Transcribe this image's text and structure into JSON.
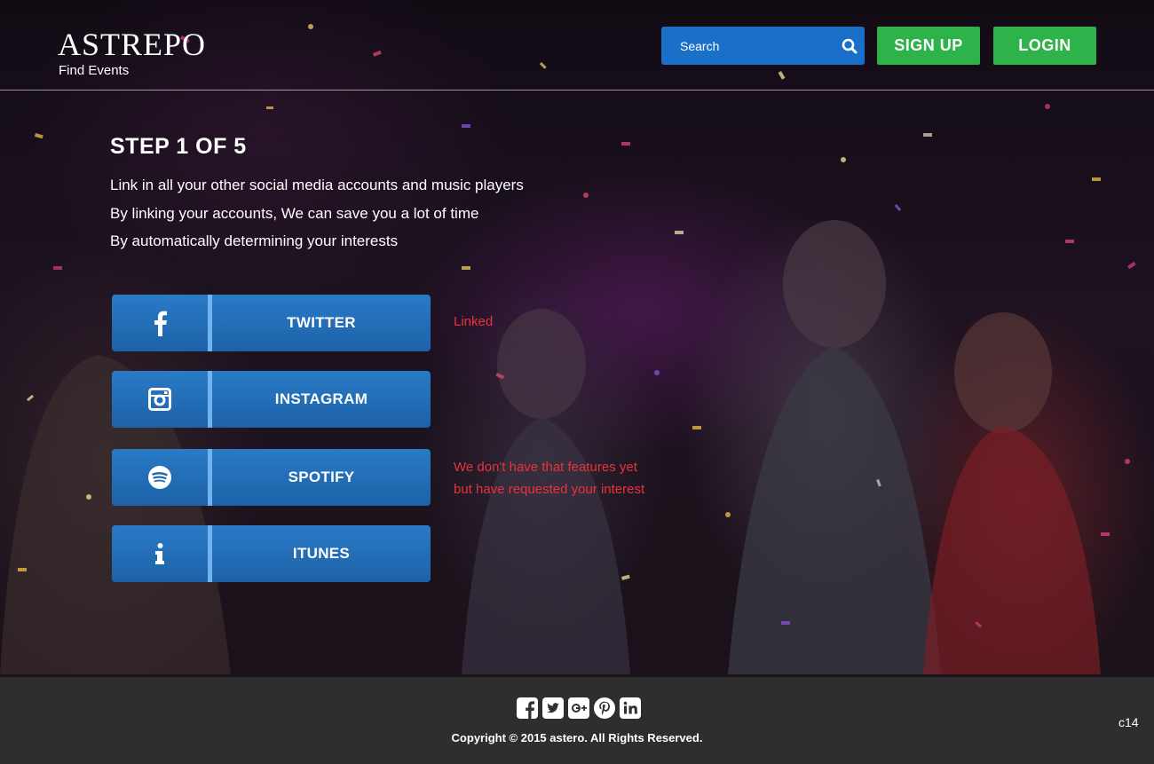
{
  "header": {
    "logo": "ASTREPO",
    "tagline": "Find Events",
    "search": {
      "placeholder": "Search",
      "icon": "search-icon"
    },
    "signup_label": "SIGN UP",
    "login_label": "LOGIN"
  },
  "main": {
    "step_title": "STEP 1 OF 5",
    "lines": [
      "Link in all your other social media accounts and music players",
      "By linking your accounts, We can save you a lot of time",
      "By automatically determining your interests"
    ],
    "services": [
      {
        "label": "TWITTER",
        "icon": "facebook-icon",
        "status": "Linked"
      },
      {
        "label": "INSTAGRAM",
        "icon": "instagram-icon",
        "status": ""
      },
      {
        "label": "SPOTIFY",
        "icon": "spotify-icon",
        "status_lines": [
          "We don't have that features yet",
          "but have requested your interest"
        ]
      },
      {
        "label": "ITUNES",
        "icon": "info-icon",
        "status": ""
      }
    ]
  },
  "footer": {
    "social_icons": [
      "facebook-square-icon",
      "twitter-square-icon",
      "google-plus-square-icon",
      "pinterest-icon",
      "linkedin-square-icon"
    ],
    "copyright": "Copyright © 2015 astero. All Rights Reserved.",
    "code": "c14"
  },
  "colors": {
    "accent_blue": "#1a6fc8",
    "button_green": "#2db34a",
    "status_red": "#e8323c",
    "footer_bg": "#303030"
  }
}
